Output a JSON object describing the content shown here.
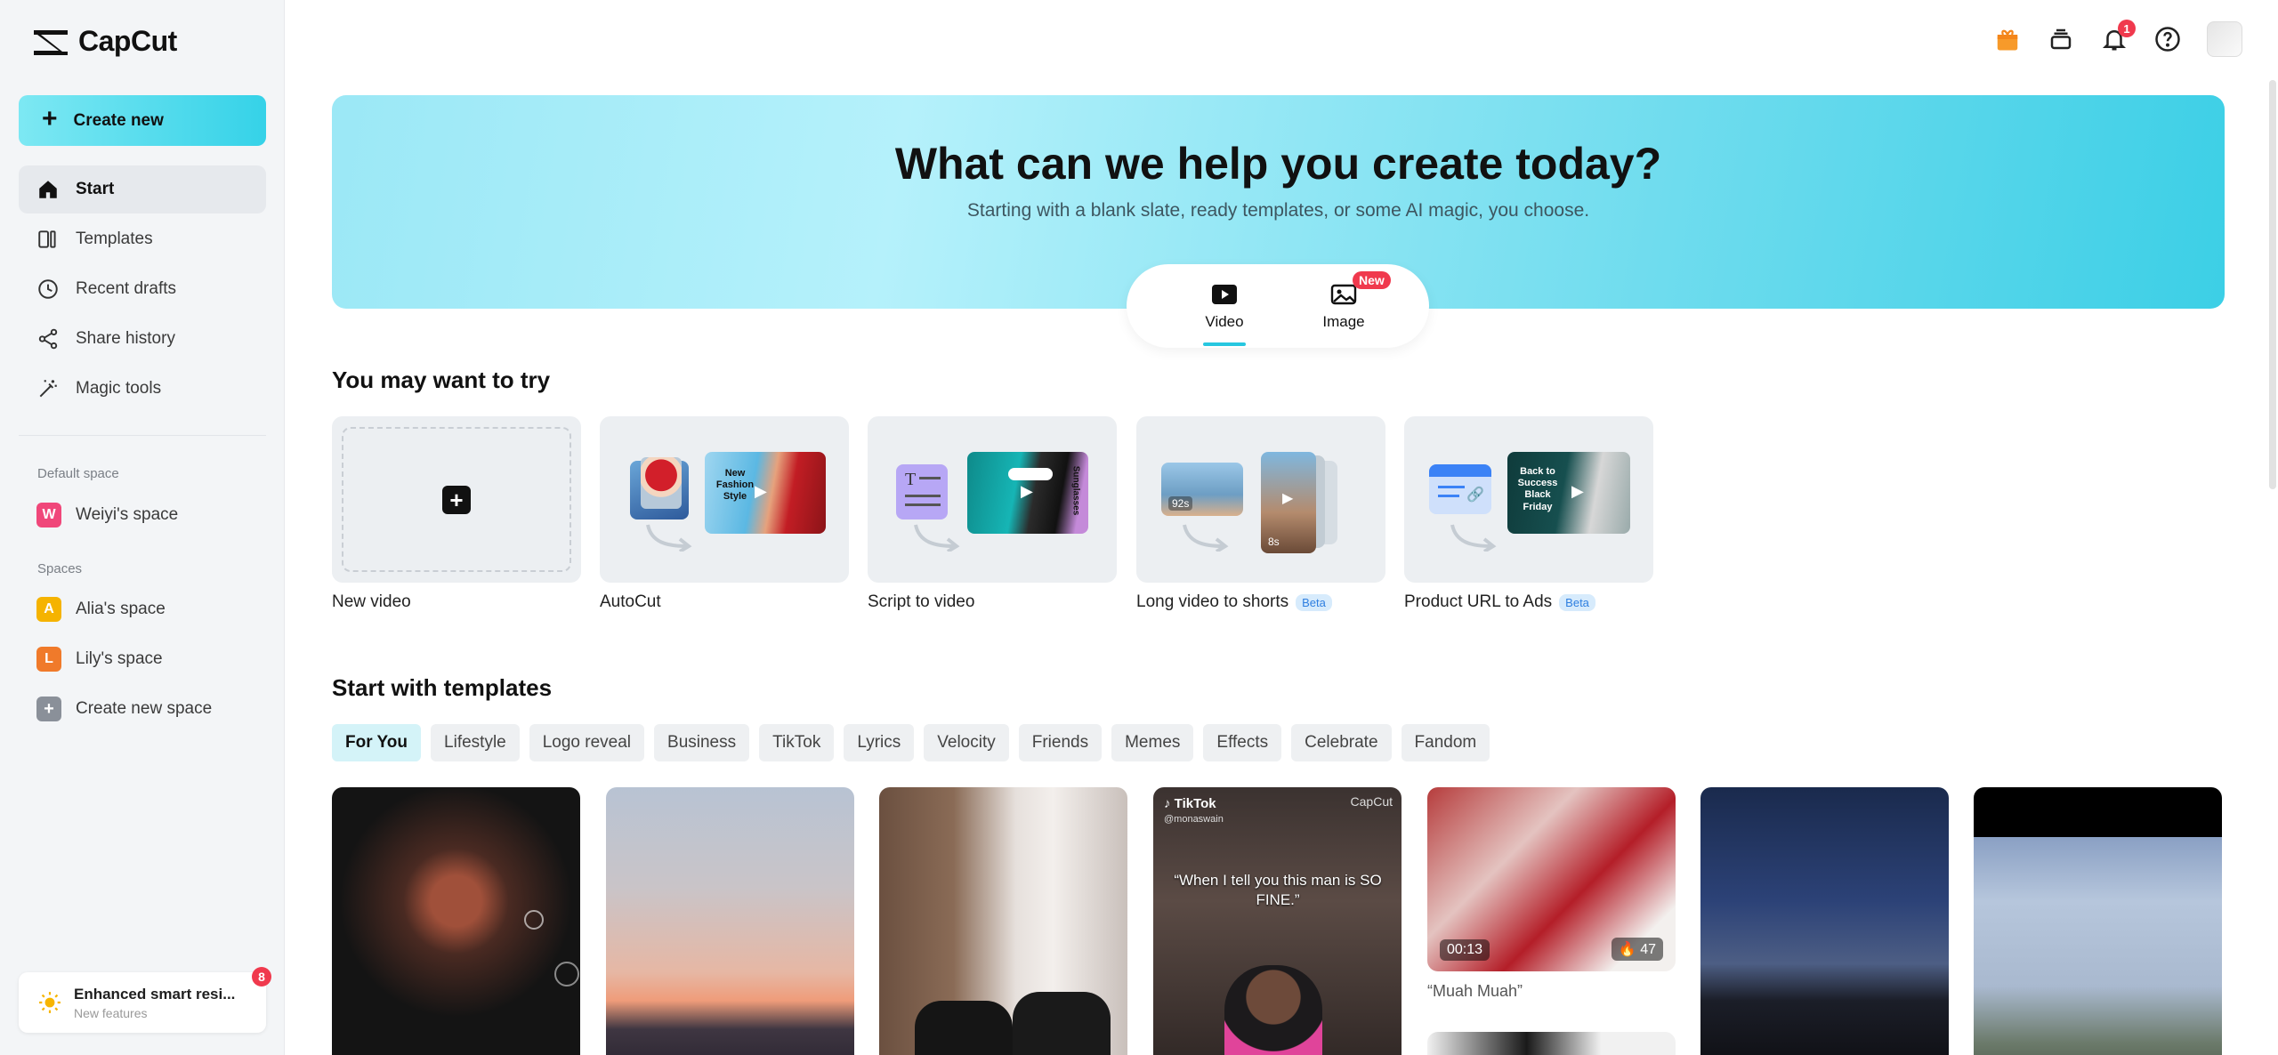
{
  "app": {
    "name": "CapCut"
  },
  "sidebar": {
    "create_label": "Create new",
    "nav": [
      {
        "label": "Start",
        "icon": "home-icon"
      },
      {
        "label": "Templates",
        "icon": "templates-icon"
      },
      {
        "label": "Recent drafts",
        "icon": "clock-icon"
      },
      {
        "label": "Share history",
        "icon": "share-icon"
      },
      {
        "label": "Magic tools",
        "icon": "magic-wand-icon"
      }
    ],
    "default_space_label": "Default space",
    "default_space": {
      "initial": "W",
      "name": "Weiyi's space",
      "color": "#f0477a"
    },
    "spaces_label": "Spaces",
    "spaces": [
      {
        "initial": "A",
        "name": "Alia's space",
        "color": "#f5b300"
      },
      {
        "initial": "L",
        "name": "Lily's space",
        "color": "#f07a2a"
      }
    ],
    "create_space_label": "Create new space",
    "notice": {
      "title": "Enhanced smart resi...",
      "subtitle": "New features",
      "count": "8"
    }
  },
  "topbar": {
    "notification_count": "1"
  },
  "hero": {
    "title": "What can we help you create today?",
    "subtitle": "Starting with a blank slate, ready templates, or some AI magic, you choose.",
    "modes": [
      {
        "label": "Video"
      },
      {
        "label": "Image",
        "tag": "New"
      }
    ]
  },
  "try_section": {
    "title": "You may want to try",
    "cards": [
      {
        "label": "New video"
      },
      {
        "label": "AutoCut",
        "overlay": "New Fashion Style"
      },
      {
        "label": "Script to video",
        "overlay": "Sunglasses"
      },
      {
        "label": "Long video to shorts",
        "beta": "Beta",
        "left_time": "92s",
        "right_time": "8s"
      },
      {
        "label": "Product URL to Ads",
        "beta": "Beta",
        "overlay": "Back to Success Black Friday"
      }
    ]
  },
  "templates": {
    "title": "Start with templates",
    "chips": [
      "For You",
      "Lifestyle",
      "Logo reveal",
      "Business",
      "TikTok",
      "Lyrics",
      "Velocity",
      "Friends",
      "Memes",
      "Effects",
      "Celebrate",
      "Fandom"
    ],
    "tiktok_card": {
      "brand": "TikTok",
      "handle": "@monaswain",
      "watermark": "CapCut",
      "quote": "“When I tell you this man is SO FINE.”"
    },
    "muah_card": {
      "duration": "00:13",
      "uses": "47",
      "caption": "“Muah Muah”"
    }
  },
  "colors": {
    "accent": "#27c7e0",
    "badge": "#f0394d",
    "sidebar_bg": "#f3f5f7"
  }
}
